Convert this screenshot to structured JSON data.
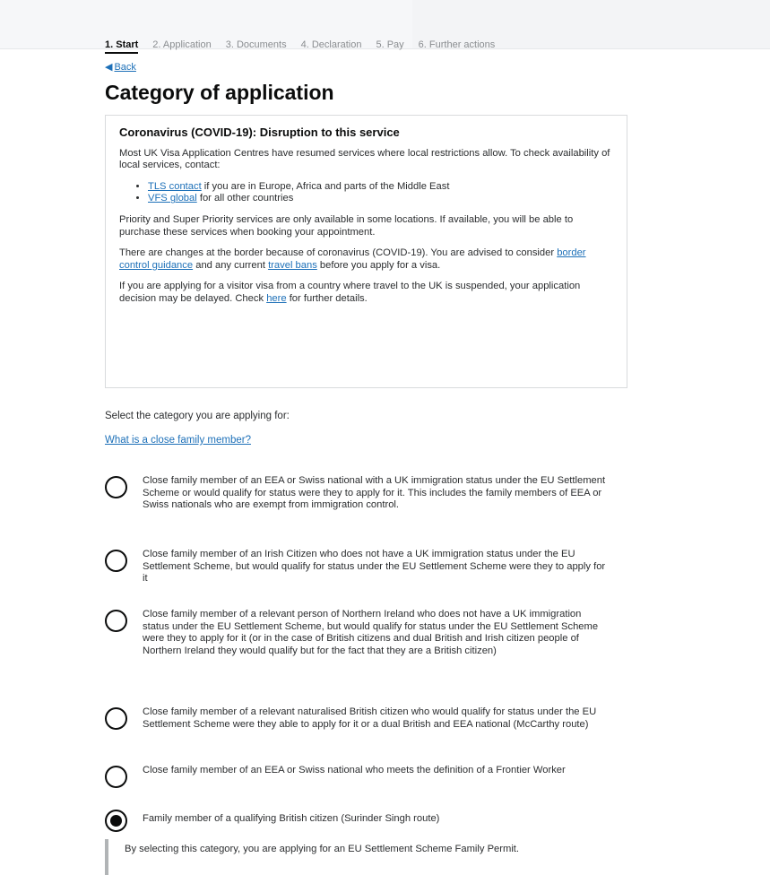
{
  "header": {
    "steps": [
      "1. Start",
      "2. Application",
      "3. Documents",
      "4. Declaration",
      "5. Pay",
      "6. Further actions"
    ]
  },
  "nav": {
    "back_label": "Back"
  },
  "page": {
    "title": "Category of application"
  },
  "covid_panel": {
    "heading": "Coronavirus (COVID-19): Disruption to this service",
    "intro": "Most UK Visa Application Centres have resumed services where local restrictions allow. To check availability of local services, contact:",
    "contacts": [
      {
        "link": "TLS contact",
        "text": " if you are in Europe, Africa and parts of the Middle East"
      },
      {
        "link": "VFS global",
        "text": " for all other countries"
      }
    ],
    "priority": "Priority and Super Priority services are only available in some locations. If available, you will be able to purchase these services when booking your appointment.",
    "border": {
      "part1": "There are changes at the border because of coronavirus (COVID-19). You are advised to consider ",
      "link1": "border control guidance",
      "part2": " and any current ",
      "link2": "travel bans",
      "part3": " before you apply for a visa."
    },
    "delay": {
      "part1": "If you are applying for a visitor visa from a country where travel to the UK is suspended, your application decision may be delayed. Check ",
      "link": "here",
      "part2": " for further details."
    }
  },
  "form": {
    "prompt": "Select the category you are applying for:",
    "help_link": "What is a close family member?",
    "options": [
      {
        "label": "Close family member of an EEA or Swiss national with a UK immigration status under the EU Settlement Scheme or would qualify for status were they to apply for it. This includes the family members of EEA or Swiss nationals who are exempt from immigration control.",
        "selected": false
      },
      {
        "label": "Close family member of an Irish Citizen who does not have a UK immigration status under the EU Settlement Scheme, but would qualify for status under the EU Settlement Scheme were they to apply for it",
        "selected": false
      },
      {
        "label": "Close family member of a relevant person of Northern Ireland who does not have a UK immigration status under the EU Settlement Scheme, but would qualify for status under the EU Settlement Scheme were they to apply for it (or in the case of British citizens and dual British and Irish citizen people of Northern Ireland they would qualify but for the fact that they are a British citizen)",
        "selected": false
      },
      {
        "label": "Close family member of a relevant naturalised British citizen who would qualify for status under the EU Settlement Scheme were they able to apply for it or a dual British and EEA national (McCarthy route)",
        "selected": false
      },
      {
        "label": "Close family member of an EEA or Swiss national who meets the definition of a Frontier Worker",
        "selected": false
      },
      {
        "label": "Family member of a qualifying British citizen (Surinder Singh route)",
        "selected": true
      }
    ],
    "conditional_text": "By selecting this category, you are applying for an EU Settlement Scheme Family Permit."
  }
}
